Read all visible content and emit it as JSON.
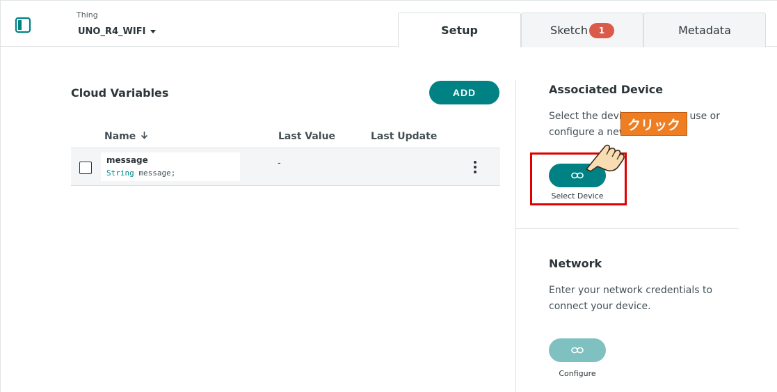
{
  "header": {
    "thing_caption": "Thing",
    "thing_name": "UNO_R4_WIFI",
    "tabs": [
      {
        "label": "Setup",
        "active": true
      },
      {
        "label": "Sketch",
        "badge": "1",
        "active": false
      },
      {
        "label": "Metadata",
        "active": false
      }
    ]
  },
  "cloud_variables": {
    "title": "Cloud Variables",
    "add_label": "ADD",
    "columns": [
      "Name",
      "Last Value",
      "Last Update"
    ],
    "rows": [
      {
        "name": "message",
        "type": "String",
        "declaration": "message;",
        "last_value": "-",
        "last_update": ""
      }
    ]
  },
  "associated_device": {
    "title": "Associated Device",
    "text_before": "Select the devic",
    "text_after": "use or",
    "text_line2": "configure a new",
    "button_label": "Select Device"
  },
  "network": {
    "title": "Network",
    "text": "Enter your network credentials to connect your device.",
    "button_label": "Configure"
  },
  "annotation": {
    "callout": "クリック"
  },
  "colors": {
    "accent": "#008184",
    "accent_disabled": "#7fc0c1",
    "badge": "#da5b4a",
    "annotation_frame": "#e00000",
    "callout": "#ef7d22"
  }
}
